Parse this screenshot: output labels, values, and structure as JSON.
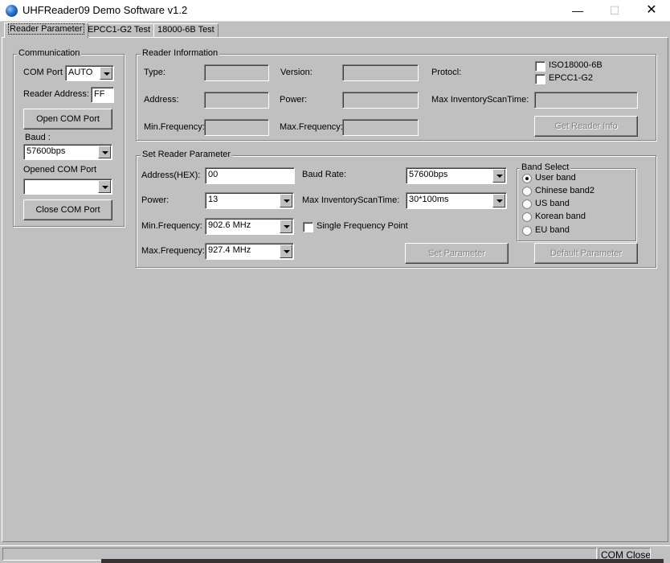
{
  "window": {
    "title": "UHFReader09 Demo Software v1.2",
    "minimize_glyph": "—",
    "maximize_glyph": "☐",
    "close_glyph": "✕"
  },
  "tabs": [
    "Reader Parameter",
    "EPCC1-G2 Test",
    "18000-6B Test"
  ],
  "communication": {
    "title": "Communication",
    "com_port_label": "COM Port",
    "com_port_value": "AUTO",
    "reader_address_label": "Reader Address:",
    "reader_address_value": "FF",
    "open_button": "Open COM Port",
    "baud_label": "Baud :",
    "baud_value": "57600bps",
    "opened_label": "Opened COM Port",
    "opened_value": "",
    "close_button": "Close COM Port"
  },
  "reader_info": {
    "title": "Reader Information",
    "type_label": "Type:",
    "version_label": "Version:",
    "protocol_label": "Protocl:",
    "address_label": "Address:",
    "power_label": "Power:",
    "max_scan_label": "Max InventoryScanTime:",
    "min_freq_label": "Min.Frequency:",
    "max_freq_label": "Max.Frequency:",
    "iso_checkbox": "ISO18000-6B",
    "epc_checkbox": "EPCC1-G2",
    "get_info_button": "Get Reader Info"
  },
  "set_param": {
    "title": "Set Reader Parameter",
    "address_label": "Address(HEX):",
    "address_value": "00",
    "baud_label": "Baud Rate:",
    "baud_value": "57600bps",
    "power_label": "Power:",
    "power_value": "13",
    "max_scan_label": "Max InventoryScanTime:",
    "max_scan_value": "30*100ms",
    "min_freq_label": "Min.Frequency:",
    "min_freq_value": "902.6 MHz",
    "single_freq_label": "Single Frequency Point",
    "max_freq_label": "Max.Frequency:",
    "max_freq_value": "927.4 MHz",
    "set_button": "Set Parameter",
    "default_button": "Default Parameter"
  },
  "band_select": {
    "title": "Band Select",
    "options": [
      "User band",
      "Chinese band2",
      "US band",
      "Korean band",
      "EU band"
    ],
    "selected": "User band"
  },
  "status": {
    "com": "COM Close"
  }
}
